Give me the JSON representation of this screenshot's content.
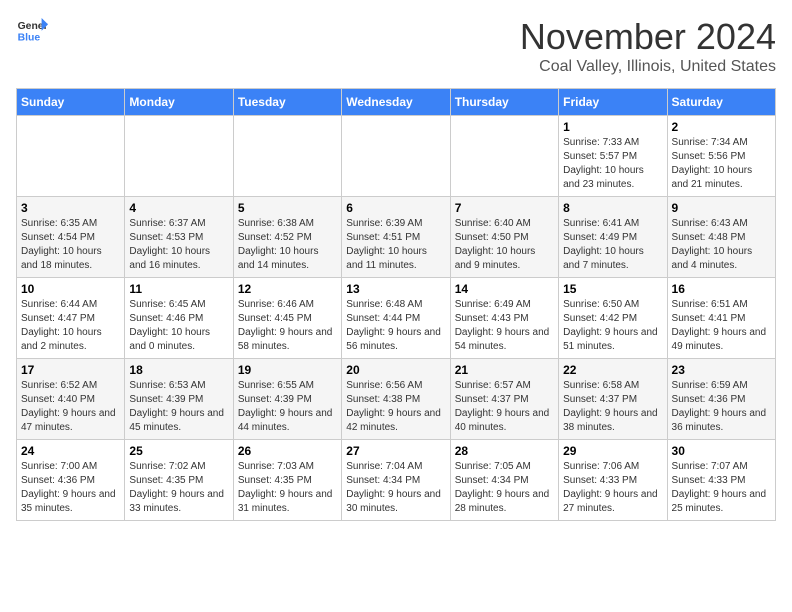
{
  "header": {
    "logo_general": "General",
    "logo_blue": "Blue",
    "month": "November 2024",
    "location": "Coal Valley, Illinois, United States"
  },
  "days_of_week": [
    "Sunday",
    "Monday",
    "Tuesday",
    "Wednesday",
    "Thursday",
    "Friday",
    "Saturday"
  ],
  "weeks": [
    [
      {
        "day": "",
        "sunrise": "",
        "sunset": "",
        "daylight": ""
      },
      {
        "day": "",
        "sunrise": "",
        "sunset": "",
        "daylight": ""
      },
      {
        "day": "",
        "sunrise": "",
        "sunset": "",
        "daylight": ""
      },
      {
        "day": "",
        "sunrise": "",
        "sunset": "",
        "daylight": ""
      },
      {
        "day": "",
        "sunrise": "",
        "sunset": "",
        "daylight": ""
      },
      {
        "day": "1",
        "sunrise": "Sunrise: 7:33 AM",
        "sunset": "Sunset: 5:57 PM",
        "daylight": "Daylight: 10 hours and 23 minutes."
      },
      {
        "day": "2",
        "sunrise": "Sunrise: 7:34 AM",
        "sunset": "Sunset: 5:56 PM",
        "daylight": "Daylight: 10 hours and 21 minutes."
      }
    ],
    [
      {
        "day": "3",
        "sunrise": "Sunrise: 6:35 AM",
        "sunset": "Sunset: 4:54 PM",
        "daylight": "Daylight: 10 hours and 18 minutes."
      },
      {
        "day": "4",
        "sunrise": "Sunrise: 6:37 AM",
        "sunset": "Sunset: 4:53 PM",
        "daylight": "Daylight: 10 hours and 16 minutes."
      },
      {
        "day": "5",
        "sunrise": "Sunrise: 6:38 AM",
        "sunset": "Sunset: 4:52 PM",
        "daylight": "Daylight: 10 hours and 14 minutes."
      },
      {
        "day": "6",
        "sunrise": "Sunrise: 6:39 AM",
        "sunset": "Sunset: 4:51 PM",
        "daylight": "Daylight: 10 hours and 11 minutes."
      },
      {
        "day": "7",
        "sunrise": "Sunrise: 6:40 AM",
        "sunset": "Sunset: 4:50 PM",
        "daylight": "Daylight: 10 hours and 9 minutes."
      },
      {
        "day": "8",
        "sunrise": "Sunrise: 6:41 AM",
        "sunset": "Sunset: 4:49 PM",
        "daylight": "Daylight: 10 hours and 7 minutes."
      },
      {
        "day": "9",
        "sunrise": "Sunrise: 6:43 AM",
        "sunset": "Sunset: 4:48 PM",
        "daylight": "Daylight: 10 hours and 4 minutes."
      }
    ],
    [
      {
        "day": "10",
        "sunrise": "Sunrise: 6:44 AM",
        "sunset": "Sunset: 4:47 PM",
        "daylight": "Daylight: 10 hours and 2 minutes."
      },
      {
        "day": "11",
        "sunrise": "Sunrise: 6:45 AM",
        "sunset": "Sunset: 4:46 PM",
        "daylight": "Daylight: 10 hours and 0 minutes."
      },
      {
        "day": "12",
        "sunrise": "Sunrise: 6:46 AM",
        "sunset": "Sunset: 4:45 PM",
        "daylight": "Daylight: 9 hours and 58 minutes."
      },
      {
        "day": "13",
        "sunrise": "Sunrise: 6:48 AM",
        "sunset": "Sunset: 4:44 PM",
        "daylight": "Daylight: 9 hours and 56 minutes."
      },
      {
        "day": "14",
        "sunrise": "Sunrise: 6:49 AM",
        "sunset": "Sunset: 4:43 PM",
        "daylight": "Daylight: 9 hours and 54 minutes."
      },
      {
        "day": "15",
        "sunrise": "Sunrise: 6:50 AM",
        "sunset": "Sunset: 4:42 PM",
        "daylight": "Daylight: 9 hours and 51 minutes."
      },
      {
        "day": "16",
        "sunrise": "Sunrise: 6:51 AM",
        "sunset": "Sunset: 4:41 PM",
        "daylight": "Daylight: 9 hours and 49 minutes."
      }
    ],
    [
      {
        "day": "17",
        "sunrise": "Sunrise: 6:52 AM",
        "sunset": "Sunset: 4:40 PM",
        "daylight": "Daylight: 9 hours and 47 minutes."
      },
      {
        "day": "18",
        "sunrise": "Sunrise: 6:53 AM",
        "sunset": "Sunset: 4:39 PM",
        "daylight": "Daylight: 9 hours and 45 minutes."
      },
      {
        "day": "19",
        "sunrise": "Sunrise: 6:55 AM",
        "sunset": "Sunset: 4:39 PM",
        "daylight": "Daylight: 9 hours and 44 minutes."
      },
      {
        "day": "20",
        "sunrise": "Sunrise: 6:56 AM",
        "sunset": "Sunset: 4:38 PM",
        "daylight": "Daylight: 9 hours and 42 minutes."
      },
      {
        "day": "21",
        "sunrise": "Sunrise: 6:57 AM",
        "sunset": "Sunset: 4:37 PM",
        "daylight": "Daylight: 9 hours and 40 minutes."
      },
      {
        "day": "22",
        "sunrise": "Sunrise: 6:58 AM",
        "sunset": "Sunset: 4:37 PM",
        "daylight": "Daylight: 9 hours and 38 minutes."
      },
      {
        "day": "23",
        "sunrise": "Sunrise: 6:59 AM",
        "sunset": "Sunset: 4:36 PM",
        "daylight": "Daylight: 9 hours and 36 minutes."
      }
    ],
    [
      {
        "day": "24",
        "sunrise": "Sunrise: 7:00 AM",
        "sunset": "Sunset: 4:36 PM",
        "daylight": "Daylight: 9 hours and 35 minutes."
      },
      {
        "day": "25",
        "sunrise": "Sunrise: 7:02 AM",
        "sunset": "Sunset: 4:35 PM",
        "daylight": "Daylight: 9 hours and 33 minutes."
      },
      {
        "day": "26",
        "sunrise": "Sunrise: 7:03 AM",
        "sunset": "Sunset: 4:35 PM",
        "daylight": "Daylight: 9 hours and 31 minutes."
      },
      {
        "day": "27",
        "sunrise": "Sunrise: 7:04 AM",
        "sunset": "Sunset: 4:34 PM",
        "daylight": "Daylight: 9 hours and 30 minutes."
      },
      {
        "day": "28",
        "sunrise": "Sunrise: 7:05 AM",
        "sunset": "Sunset: 4:34 PM",
        "daylight": "Daylight: 9 hours and 28 minutes."
      },
      {
        "day": "29",
        "sunrise": "Sunrise: 7:06 AM",
        "sunset": "Sunset: 4:33 PM",
        "daylight": "Daylight: 9 hours and 27 minutes."
      },
      {
        "day": "30",
        "sunrise": "Sunrise: 7:07 AM",
        "sunset": "Sunset: 4:33 PM",
        "daylight": "Daylight: 9 hours and 25 minutes."
      }
    ]
  ]
}
